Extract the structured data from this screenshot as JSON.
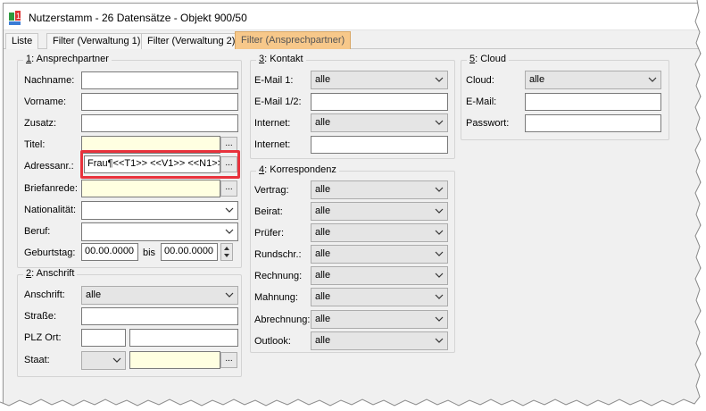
{
  "window": {
    "title": "Nutzerstamm - 26 Datensätze - Objekt 900/50",
    "app_icon_text": "1"
  },
  "tabs": [
    {
      "label": "Liste"
    },
    {
      "label": "Filter (Verwaltung 1)"
    },
    {
      "label": "Filter (Verwaltung 2)"
    },
    {
      "label": "Filter (Ansprechpartner)",
      "active": true
    }
  ],
  "ansprechpartner": {
    "num": "1",
    "title": ": Ansprechpartner",
    "nachname_label": "Nachname:",
    "vorname_label": "Vorname:",
    "zusatz_label": "Zusatz:",
    "titel_label": "Titel:",
    "adressanr_label": "Adressanr.:",
    "adressanr_value": "Frau¶<<T1>> <<V1>> <<N1>>",
    "briefanrede_label": "Briefanrede:",
    "nationalitaet_label": "Nationalität:",
    "beruf_label": "Beruf:",
    "geburtstag_label": "Geburtstag:",
    "geburtstag_from": "00.00.0000",
    "bis_label": "bis",
    "geburtstag_to": "00.00.0000",
    "ellipsis": "..."
  },
  "anschrift": {
    "num": "2",
    "title": ": Anschrift",
    "anschrift_label": "Anschrift:",
    "anschrift_value": "alle",
    "strasse_label": "Straße:",
    "plz_ort_label": "PLZ Ort:",
    "staat_label": "Staat:"
  },
  "kontakt": {
    "num": "3",
    "title": ": Kontakt",
    "email1_label": "E-Mail 1:",
    "email1_value": "alle",
    "email12_label": "E-Mail 1/2:",
    "internet1_label": "Internet:",
    "internet1_value": "alle",
    "internet2_label": "Internet:"
  },
  "korrespondenz": {
    "num": "4",
    "title": ": Korrespondenz",
    "rows": [
      {
        "label": "Vertrag:",
        "value": "alle"
      },
      {
        "label": "Beirat:",
        "value": "alle"
      },
      {
        "label": "Prüfer:",
        "value": "alle"
      },
      {
        "label": "Rundschr.:",
        "value": "alle"
      },
      {
        "label": "Rechnung:",
        "value": "alle"
      },
      {
        "label": "Mahnung:",
        "value": "alle"
      },
      {
        "label": "Abrechnung:",
        "value": "alle"
      },
      {
        "label": "Outlook:",
        "value": "alle"
      }
    ]
  },
  "cloud": {
    "num": "5",
    "title": ": Cloud",
    "cloud_label": "Cloud:",
    "cloud_value": "alle",
    "email_label": "E-Mail:",
    "passwort_label": "Passwort:"
  },
  "colors": {
    "active_tab": "#f7c88a",
    "highlight_box": "#e8323c",
    "yellow_field": "#ffffe1"
  }
}
